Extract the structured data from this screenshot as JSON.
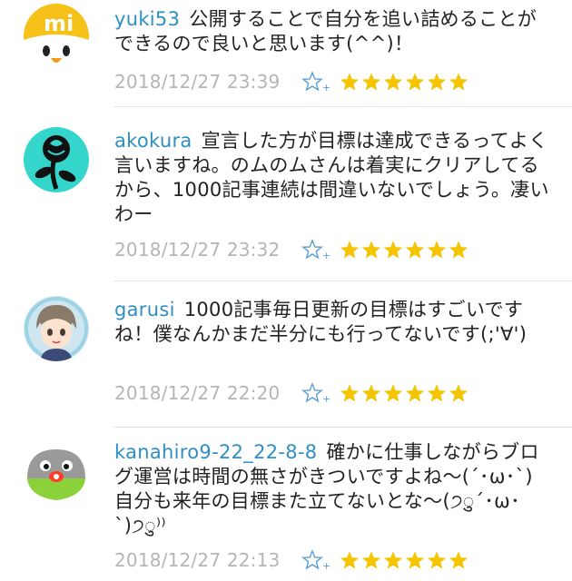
{
  "comments": [
    {
      "username": "yuki53",
      "text": "公開することで自分を追い詰めることができるので良いと思います(^^)！",
      "timestamp": "2018/12/27 23:39",
      "star_count": 6
    },
    {
      "username": "akokura",
      "text": "宣言した方が目標は達成できるってよく言いますね。のムのムさんは着実にクリアしてるから、1000記事連続は間違いないでしょう。凄いわー",
      "timestamp": "2018/12/27 23:32",
      "star_count": 6
    },
    {
      "username": "garusi",
      "text": "1000記事毎日更新の目標はすごいですね！僕なんかまだ半分にも行ってないです(;'∀')",
      "timestamp": "2018/12/27 22:20",
      "star_count": 6
    },
    {
      "username": "kanahiro9-22_22-8-8",
      "text": "確かに仕事しながらブログ運営は時間の無さがきついですよね〜(´･ω･`)自分も来年の目標また立てないとな〜(੭ु´･ω･`)੭ु⁾⁾",
      "timestamp": "2018/12/27 22:13",
      "star_count": 6
    }
  ],
  "colors": {
    "username": "#2d8fc4",
    "timestamp": "#b5b5b5",
    "star": "#f5c400",
    "star_add": "#5a9fd6"
  },
  "icons": {
    "avatar_1": "mi-duck-avatar",
    "avatar_2": "black-rose-avatar",
    "avatar_3": "anime-boy-avatar",
    "avatar_4": "green-bird-avatar",
    "star_add": "add-star-icon",
    "star": "star-icon"
  }
}
